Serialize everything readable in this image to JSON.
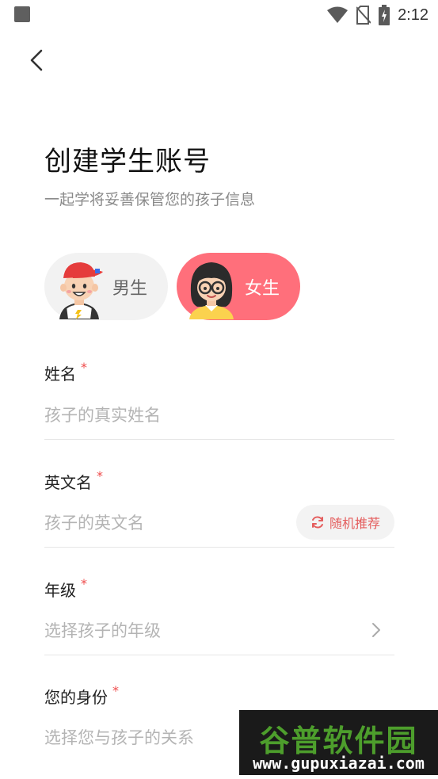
{
  "status_bar": {
    "time": "2:12"
  },
  "header": {
    "title": "创建学生账号",
    "subtitle": "一起学将妥善保管您的孩子信息"
  },
  "gender": {
    "male_label": "男生",
    "female_label": "女生",
    "selected": "female",
    "selected_color": "#ff6f7b"
  },
  "form": {
    "name": {
      "label": "姓名",
      "placeholder": "孩子的真实姓名",
      "required_mark": "*"
    },
    "english_name": {
      "label": "英文名",
      "placeholder": "孩子的英文名",
      "required_mark": "*",
      "random_button": "随机推荐"
    },
    "grade": {
      "label": "年级",
      "placeholder": "选择孩子的年级",
      "required_mark": "*"
    },
    "identity": {
      "label": "您的身份",
      "placeholder": "选择您与孩子的关系",
      "required_mark": "*"
    }
  },
  "watermark": {
    "title": "谷普软件园",
    "url": "www.gupuxiazai.com"
  }
}
